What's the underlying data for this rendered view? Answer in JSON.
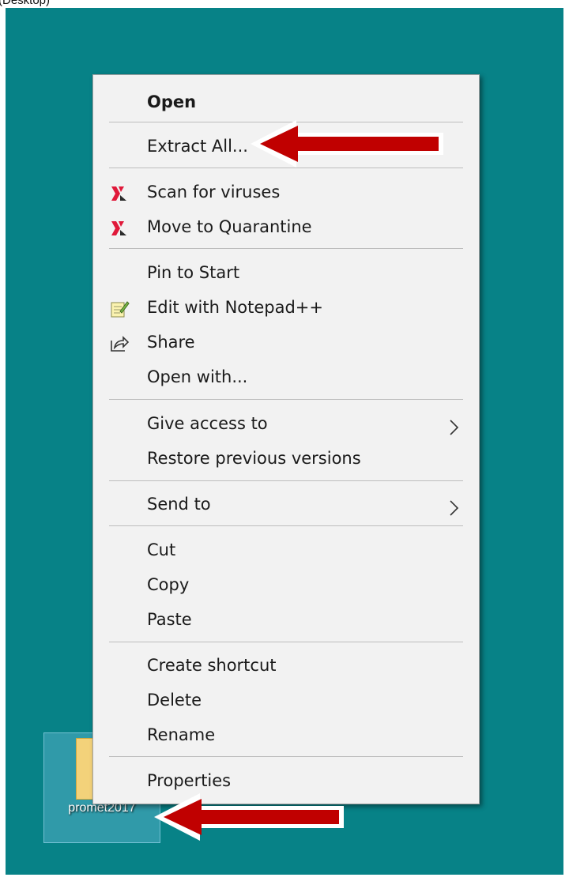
{
  "caption": "(Desktop)",
  "colors": {
    "desktop": "#078287",
    "menu_bg": "#f2f2f2",
    "arrow": "#c00000"
  },
  "desktop_item": {
    "name": "promet2017",
    "icon": "zip-folder-icon"
  },
  "menu": {
    "items": [
      {
        "label": "Open",
        "bold": true
      },
      {
        "label": "Extract All..."
      },
      {
        "label": "Scan for viruses",
        "icon": "kaspersky-icon"
      },
      {
        "label": "Move to Quarantine",
        "icon": "kaspersky-icon"
      },
      {
        "label": "Pin to Start"
      },
      {
        "label": "Edit with Notepad++",
        "icon": "notepad-plus-plus-icon"
      },
      {
        "label": "Share",
        "icon": "share-icon"
      },
      {
        "label": "Open with..."
      },
      {
        "label": "Give access to",
        "submenu": true
      },
      {
        "label": "Restore previous versions"
      },
      {
        "label": "Send to",
        "submenu": true
      },
      {
        "label": "Cut"
      },
      {
        "label": "Copy"
      },
      {
        "label": "Paste"
      },
      {
        "label": "Create shortcut"
      },
      {
        "label": "Delete"
      },
      {
        "label": "Rename"
      },
      {
        "label": "Properties"
      }
    ]
  },
  "annotations": [
    {
      "target": "Extract All...",
      "type": "red-arrow"
    },
    {
      "target": "promet2017",
      "type": "red-arrow"
    }
  ]
}
